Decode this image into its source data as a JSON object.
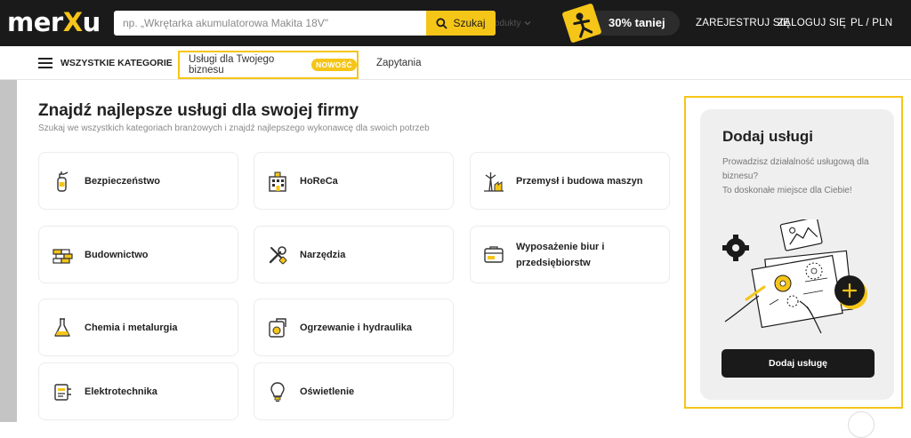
{
  "header": {
    "logo_left": "mer",
    "logo_x": "X",
    "logo_right": "u",
    "search_placeholder": "np. „Wkrętarka akumulatorowa Makita 18V\"",
    "search_scope": "Produkty",
    "search_button": "Szukaj",
    "promo": "30% taniej",
    "register": "ZAREJESTRUJ SIĘ",
    "login": "ZALOGUJ SIĘ",
    "locale": "PL / PLN"
  },
  "nav": {
    "all_categories": "WSZYSTKIE KATEGORIE",
    "services_tab": "Usługi dla Twojego biznesu",
    "new_badge": "NOWOŚĆ",
    "queries_tab": "Zapytania"
  },
  "main": {
    "title": "Znajdź najlepsze usługi dla swojej firmy",
    "subtitle": "Szukaj we wszystkich kategoriach branżowych i znajdź najlepszego wykonawcę dla swoich potrzeb",
    "categories": [
      {
        "label": "Bezpieczeństwo",
        "icon": "fire-extinguisher-icon"
      },
      {
        "label": "HoReCa",
        "icon": "hotel-icon"
      },
      {
        "label": "Przemysł i budowa maszyn",
        "icon": "industry-icon"
      },
      {
        "label": "Budownictwo",
        "icon": "bricks-icon"
      },
      {
        "label": "Narzędzia",
        "icon": "tools-icon"
      },
      {
        "label": "Wyposażenie biur i przedsiębiorstw",
        "icon": "office-equipment-icon"
      },
      {
        "label": "Chemia i metalurgia",
        "icon": "flask-icon"
      },
      {
        "label": "Ogrzewanie i hydraulika",
        "icon": "heating-icon"
      },
      {
        "label": "Elektrotechnika",
        "icon": "electric-panel-icon"
      },
      {
        "label": "Oświetlenie",
        "icon": "bulb-icon"
      }
    ]
  },
  "sidebar": {
    "title": "Dodaj usługi",
    "description": "Prowadzisz działalność usługową dla biznesu?\nTo doskonałe miejsce dla Ciebie!",
    "button": "Dodaj usługę"
  },
  "colors": {
    "accent": "#f5c518",
    "dark": "#1a1a1a"
  }
}
